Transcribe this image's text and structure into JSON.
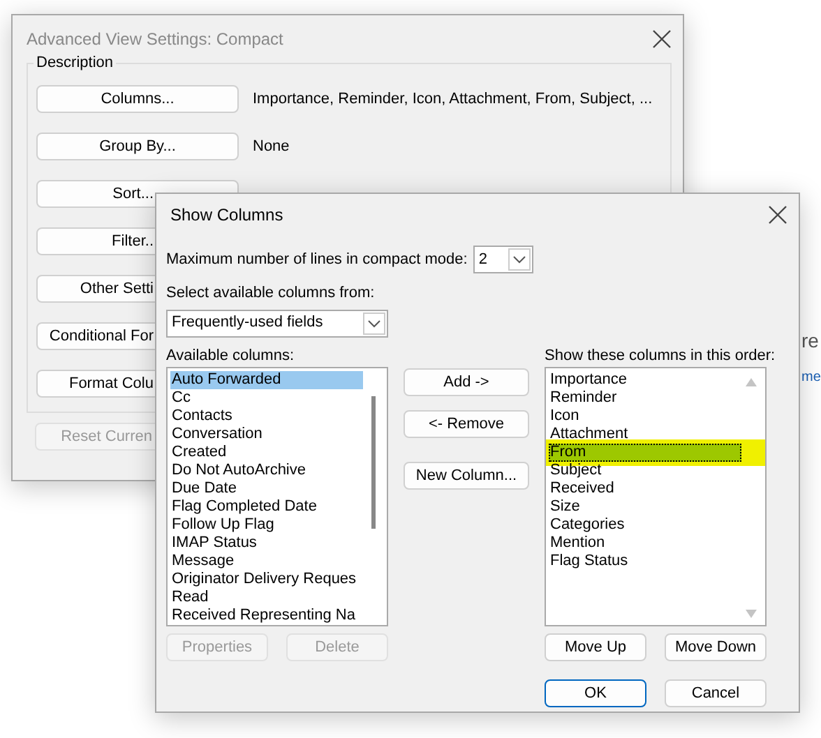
{
  "back_dialog": {
    "title": "Advanced View Settings: Compact",
    "group_label": "Description",
    "rows": [
      {
        "button": "Columns...",
        "value": "Importance, Reminder, Icon, Attachment, From, Subject, ..."
      },
      {
        "button": "Group By...",
        "value": "None"
      },
      {
        "button": "Sort..."
      },
      {
        "button": "Filter.."
      },
      {
        "button": "Other Setti"
      },
      {
        "button": "Conditional For"
      },
      {
        "button": "Format Colu"
      }
    ],
    "reset_button": {
      "label": "Reset Curren",
      "disabled": true
    }
  },
  "front_dialog": {
    "title": "Show Columns",
    "max_lines_label": "Maximum number of lines in compact mode:",
    "max_lines_value": "2",
    "source_label": "Select available columns from:",
    "source_value": "Frequently-used fields",
    "available_label": "Available columns:",
    "available_columns": [
      {
        "label": "Auto Forwarded",
        "selected": true
      },
      {
        "label": "Cc",
        "selected": false
      },
      {
        "label": "Contacts",
        "selected": false
      },
      {
        "label": "Conversation",
        "selected": false
      },
      {
        "label": "Created",
        "selected": false
      },
      {
        "label": "Do Not AutoArchive",
        "selected": false
      },
      {
        "label": "Due Date",
        "selected": false
      },
      {
        "label": "Flag Completed Date",
        "selected": false
      },
      {
        "label": "Follow Up Flag",
        "selected": false
      },
      {
        "label": "IMAP Status",
        "selected": false
      },
      {
        "label": "Message",
        "selected": false
      },
      {
        "label": "Originator Delivery Reques",
        "selected": false
      },
      {
        "label": "Read",
        "selected": false
      },
      {
        "label": "Received Representing Na",
        "selected": false
      }
    ],
    "middle_buttons": [
      "Add ->",
      "<- Remove",
      "New Column..."
    ],
    "list_buttons": [
      {
        "label": "Properties",
        "disabled": true
      },
      {
        "label": "Delete",
        "disabled": true
      }
    ],
    "shown_label": "Show these columns in this order:",
    "shown_columns": [
      {
        "label": "Importance",
        "selected": false,
        "highlighted": false
      },
      {
        "label": "Reminder",
        "selected": false,
        "highlighted": false
      },
      {
        "label": "Icon",
        "selected": false,
        "highlighted": false
      },
      {
        "label": "Attachment",
        "selected": false,
        "highlighted": false
      },
      {
        "label": "From",
        "selected": true,
        "highlighted": true
      },
      {
        "label": "Subject",
        "selected": false,
        "highlighted": false
      },
      {
        "label": "Received",
        "selected": false,
        "highlighted": false
      },
      {
        "label": "Size",
        "selected": false,
        "highlighted": false
      },
      {
        "label": "Categories",
        "selected": false,
        "highlighted": false
      },
      {
        "label": "Mention",
        "selected": false,
        "highlighted": false
      },
      {
        "label": "Flag Status",
        "selected": false,
        "highlighted": false
      }
    ],
    "order_buttons": [
      "Move Up",
      "Move Down"
    ],
    "ok_button": "OK",
    "cancel_button": "Cancel"
  },
  "background_text": [
    {
      "text": "re",
      "kind": "heading"
    },
    {
      "text": "me",
      "kind": "link"
    }
  ]
}
